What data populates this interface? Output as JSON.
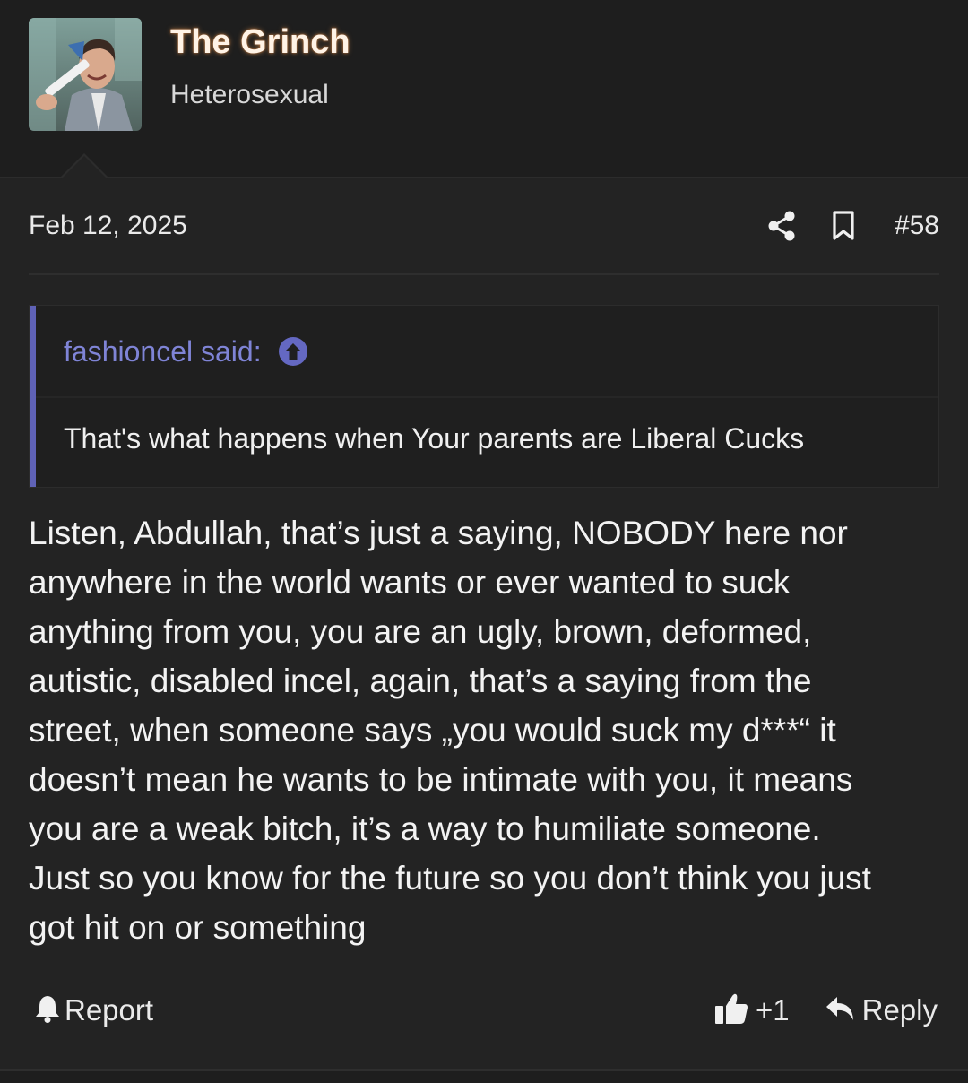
{
  "user": {
    "name": "The Grinch",
    "title": "Heterosexual",
    "avatar_icon": "user-avatar"
  },
  "post": {
    "date": "Feb 12, 2025",
    "number": "#58",
    "share_icon": "share-icon",
    "bookmark_icon": "bookmark-icon",
    "quote": {
      "author_label": "fashioncel said:",
      "jump_icon": "arrow-up-circle-icon",
      "text": "That's what happens when Your parents are Liberal Cucks"
    },
    "message_lines": [
      "Listen, Abdullah, that’s just a saying, NOBODY here nor",
      "anywhere in the world wants or ever wanted to suck",
      "anything from you, you are an ugly, brown, deformed,",
      "autistic, disabled incel, again, that’s a saying from the",
      "street, when someone says „you would suck my d***“ it",
      "doesn’t mean he wants to be intimate with you, it means",
      "you are a weak bitch, it’s a way to humiliate someone.",
      "Just so you know for the future so you don’t think you just",
      "got hit on or something"
    ]
  },
  "footer": {
    "report_label": "Report",
    "like_count": "+1",
    "reply_label": "Reply"
  },
  "colors": {
    "background": "#1e1e1e",
    "post_background": "#232323",
    "quote_accent": "#5f62b6",
    "quote_author": "#7f84d6",
    "username_glow": "#ffaa5a"
  }
}
